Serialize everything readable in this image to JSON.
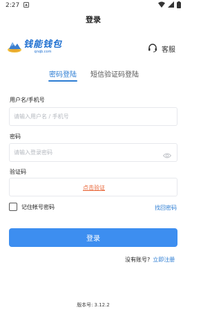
{
  "statusbar": {
    "time": "2:27"
  },
  "header": {
    "title": "登录"
  },
  "logo": {
    "name": "钱能钱包",
    "subtitle": "qnqb.com"
  },
  "service": {
    "label": "客服"
  },
  "tabs": [
    {
      "label": "密码登陆",
      "active": true
    },
    {
      "label": "短信验证码登陆",
      "active": false
    }
  ],
  "form": {
    "username_label": "用户名/手机号",
    "username_placeholder": "请输入用户名 / 手机号",
    "password_label": "密码",
    "password_placeholder": "请输入登录密码",
    "captcha_label": "验证码",
    "captcha_button": "点击验证",
    "remember_label": "记住帐号密码",
    "forgot_label": "找回密码",
    "login_button": "登录",
    "no_account": "没有账号?",
    "register_link": "立即注册"
  },
  "footer": {
    "version_label": "版本号:",
    "version_value": "3.12.2"
  },
  "colors": {
    "primary": "#3d8ef0",
    "link": "#2b7cd3",
    "accent": "#e8683b"
  }
}
